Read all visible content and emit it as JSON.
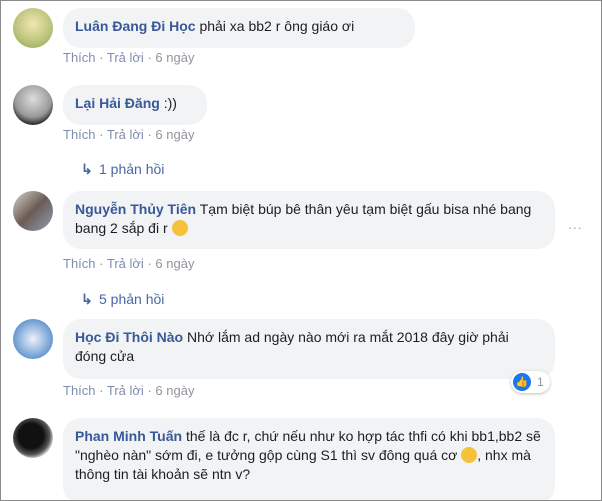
{
  "actions": {
    "like": "Thích",
    "reply": "Trả lời",
    "separator": "·"
  },
  "comments": [
    {
      "author": "Luân Đang Đi Học",
      "text": "phải xa bb2 r ông giáo ơi",
      "time": "6 ngày"
    },
    {
      "author": "Lại Hải Đăng",
      "text": ":))",
      "time": "6 ngày",
      "replies": "1 phản hồi"
    },
    {
      "author": "Nguyễn Thủy Tiên",
      "text": "Tạm biệt búp bê thân yêu tạm biệt gấu bisa nhé bang bang 2 sắp đi r",
      "emoji": "disappointed-face",
      "time": "6 ngày",
      "replies": "5 phản hồi"
    },
    {
      "author": "Học Đi Thôi Nào",
      "text": "Nhớ lắm ad ngày nào mới ra mắt 2018 đây giờ phải đóng cửa",
      "time": "6 ngày",
      "likes": "1"
    },
    {
      "author": "Phan Minh Tuấn",
      "text_before": "thế là đc r, chứ nếu như ko hợp tác thfi có khi bb1,bb2 sẽ \"nghèo nàn\" sớm đi, e tưởng gộp cùng S1 thì sv đông quá cơ",
      "emoji": "confused-face",
      "text_after": ", nhx mà thông tin tài khoản sẽ ntn v?"
    }
  ],
  "more_options": "...",
  "colors": {
    "name": "#385898",
    "bubble": "#f2f3f5",
    "like": "#1877f2"
  }
}
